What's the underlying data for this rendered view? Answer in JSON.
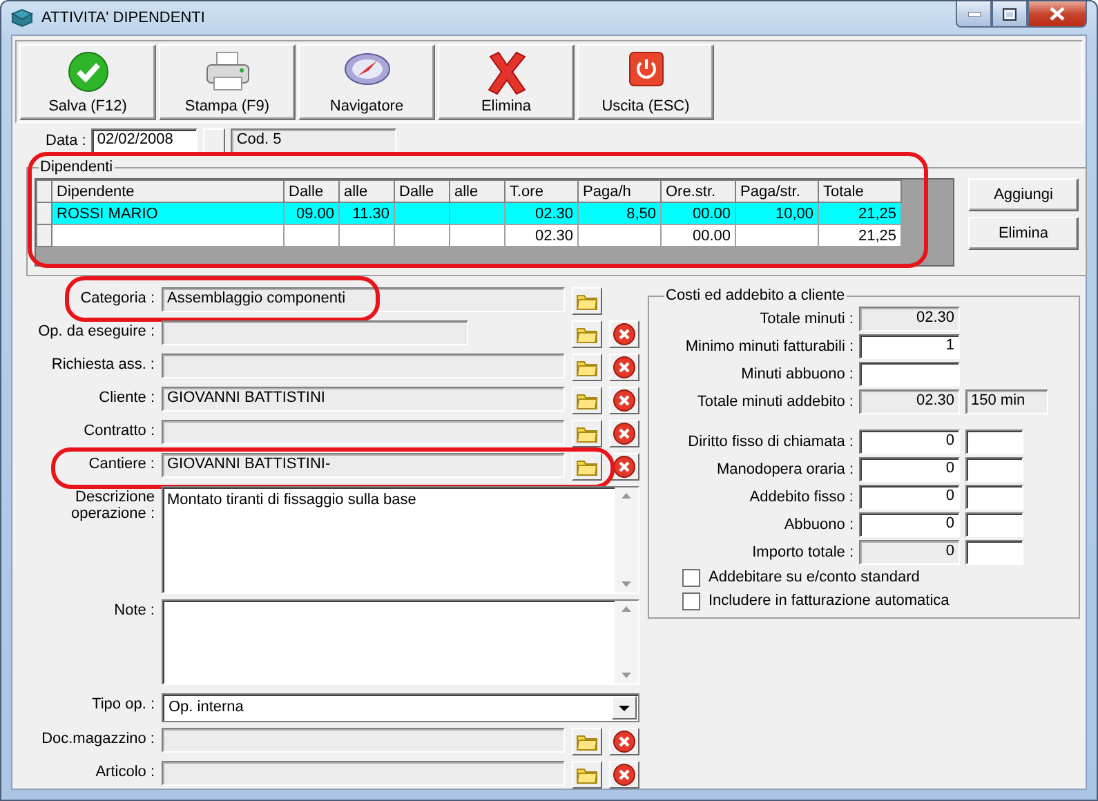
{
  "window": {
    "title": "ATTIVITA' DIPENDENTI"
  },
  "toolbar": [
    {
      "label": "Salva (F12)",
      "kind": "save"
    },
    {
      "label": "Stampa (F9)",
      "kind": "print"
    },
    {
      "label": "Navigatore",
      "kind": "navigator"
    },
    {
      "label": "Elimina",
      "kind": "delete"
    },
    {
      "label": "Uscita (ESC)",
      "kind": "exit"
    }
  ],
  "date": {
    "label": "Data :",
    "value": "02/02/2008",
    "code": "Cod. 5"
  },
  "dipendenti": {
    "title": "Dipendenti",
    "highlighted": true,
    "columns": [
      "Dipendente",
      "Dalle",
      "alle",
      "Dalle",
      "alle",
      "T.ore",
      "Paga/h",
      "Ore.str.",
      "Paga/str.",
      "Totale"
    ],
    "rows": [
      {
        "selected": true,
        "cells": [
          "ROSSI MARIO",
          "09.00",
          "11.30",
          "",
          "",
          "02.30",
          "8,50",
          "00.00",
          "10,00",
          "21,25"
        ]
      },
      {
        "selected": false,
        "cells": [
          "",
          "",
          "",
          "",
          "",
          "02.30",
          "",
          "00.00",
          "",
          "21,25"
        ]
      }
    ],
    "buttons": [
      "Aggiungi",
      "Elimina"
    ]
  },
  "fields": [
    {
      "label": "Categoria :",
      "value": "Assemblaggio componenti",
      "kind": "lookup",
      "readonly": true,
      "clear": false,
      "highlighted": true
    },
    {
      "label": "Op. da eseguire :",
      "kind": "short",
      "readonly": true,
      "clear": true,
      "highlighted": false
    },
    {
      "label": "Richiesta ass. :",
      "kind": "lookup",
      "readonly": true,
      "clear": true,
      "highlighted": false
    },
    {
      "label": "Cliente :",
      "value": "GIOVANNI BATTISTINI",
      "kind": "lookup",
      "readonly": true,
      "clear": true,
      "highlighted": false
    },
    {
      "label": "Contratto :",
      "kind": "lookup",
      "readonly": true,
      "clear": true,
      "highlighted": false
    },
    {
      "label": "Cantiere :",
      "value": "GIOVANNI BATTISTINI-",
      "kind": "lookup",
      "readonly": true,
      "clear": true,
      "highlighted": true
    },
    {
      "label": "Descrizione operazione :",
      "value": "Montato tiranti di fissaggio sulla base",
      "kind": "memo",
      "readonly": false,
      "clear": false,
      "highlighted": false
    },
    {
      "label": "Note :",
      "kind": "memo",
      "readonly": false,
      "clear": false,
      "highlighted": false
    },
    {
      "label": "Tipo op. :",
      "value": "Op. interna",
      "kind": "combo",
      "readonly": false,
      "clear": false,
      "highlighted": false
    },
    {
      "label": "Doc.magazzino :",
      "kind": "lookup",
      "readonly": true,
      "clear": true,
      "highlighted": false
    },
    {
      "label": "Articolo :",
      "kind": "lookup",
      "readonly": true,
      "clear": true,
      "highlighted": false
    }
  ],
  "costs": {
    "title": "Costi ed addebito a cliente",
    "time_rows": [
      {
        "label": "Totale minuti :",
        "value": "02.30",
        "readonly": true
      },
      {
        "label": "Minimo minuti fatturabili :",
        "value": "1",
        "readonly": false
      },
      {
        "label": "Minuti abbuono :",
        "readonly": false
      },
      {
        "label": "Totale minuti addebito :",
        "value": "02.30",
        "readonly": true,
        "side": {
          "value": "150 min",
          "readonly": true
        }
      }
    ],
    "cost_rows": [
      {
        "label": "Diritto fisso di chiamata :",
        "value": "0",
        "readonly": false,
        "side": {
          "readonly": false
        }
      },
      {
        "label": "Manodopera oraria :",
        "value": "0",
        "readonly": false,
        "side": {
          "readonly": false
        }
      },
      {
        "label": "Addebito fisso :",
        "value": "0",
        "readonly": false,
        "side": {
          "readonly": false
        }
      },
      {
        "label": "Abbuono :",
        "value": "0",
        "readonly": false,
        "side": {
          "readonly": false
        }
      },
      {
        "label": "Importo totale :",
        "value": "0",
        "readonly": true,
        "side": {
          "readonly": false
        }
      }
    ],
    "checkboxes": [
      {
        "label": "Addebitare su e/conto standard",
        "checked": false
      },
      {
        "label": "Includere in fatturazione automatica",
        "checked": false
      }
    ]
  }
}
